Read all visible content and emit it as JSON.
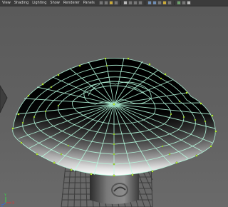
{
  "menubar": {
    "items": [
      "View",
      "Shading",
      "Lighting",
      "Show",
      "Renderer",
      "Panels"
    ]
  },
  "toolbar": {
    "icons": [
      "camera-select-icon",
      "camera-lock-icon",
      "bookmark-icon",
      "image-plane-icon",
      "grid-toggle-icon",
      "film-gate-icon",
      "resolution-gate-icon",
      "safe-action-icon",
      "wireframe-icon",
      "smooth-shade-icon",
      "textured-icon",
      "lights-icon",
      "shadows-icon",
      "xray-icon",
      "isolate-icon",
      "hud-icon"
    ]
  },
  "viewport": {
    "background_color": "#5e5e5e",
    "wire_color": "#b8ffe2",
    "vertex_color": "#c8ff3a",
    "grid_color": "#3a3a3a",
    "axis_labels": {
      "x": "X",
      "y": "Y",
      "z": "Z"
    }
  }
}
